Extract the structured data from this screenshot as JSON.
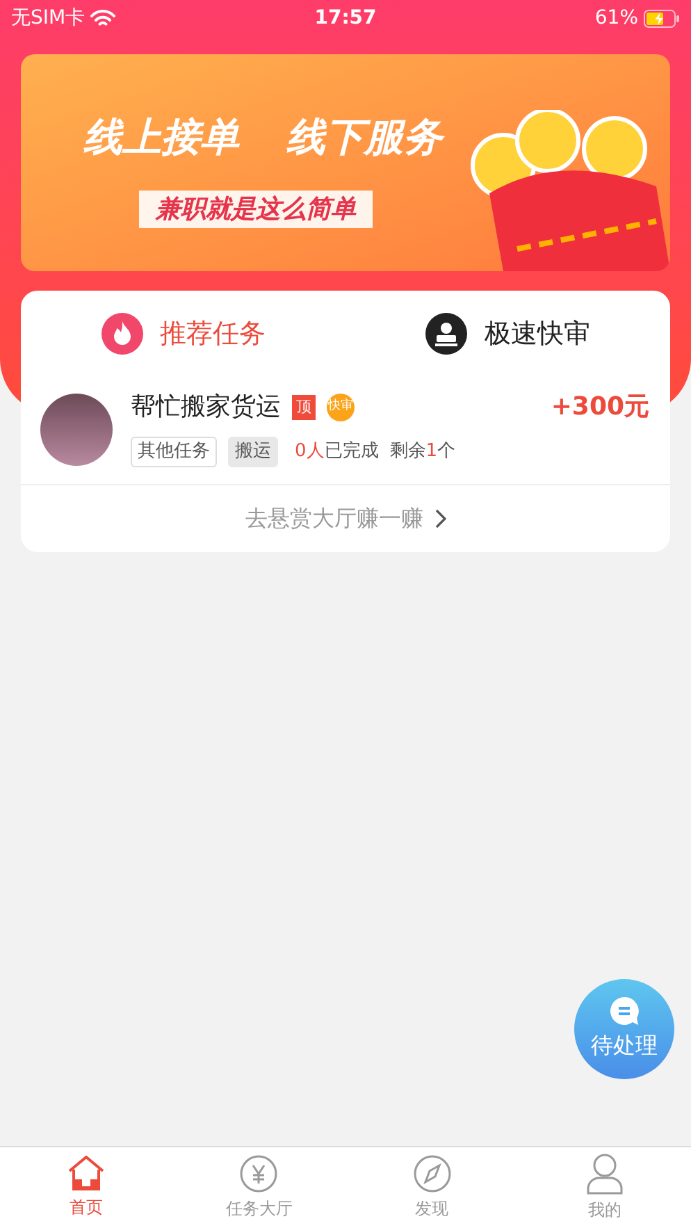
{
  "status_bar": {
    "carrier": "无SIM卡",
    "time": "17:57",
    "battery": "61%",
    "charging": true
  },
  "banner": {
    "headline_1": "线上接单",
    "headline_2": "线下服务",
    "slogan": "兼职就是这么简单"
  },
  "tabs": [
    {
      "label": "推荐任务",
      "kind": "flame",
      "selected": true
    },
    {
      "label": "极速快审",
      "kind": "stamp",
      "selected": false
    }
  ],
  "tasks": [
    {
      "title": "帮忙搬家货运",
      "top_badge": "顶",
      "fast_badge": "快审",
      "reward": "+300元",
      "tags": [
        {
          "label": "其他任务",
          "kind": "outline"
        },
        {
          "label": "搬运",
          "kind": "filled"
        }
      ],
      "completed_count": "0人",
      "completed_label": "已完成",
      "remaining_label": "剩余",
      "remaining_count": "1",
      "remaining_unit": "个"
    }
  ],
  "more_link": "去悬赏大厅赚一赚",
  "floating_button": "待处理",
  "nav": [
    {
      "label": "首页",
      "kind": "home",
      "selected": true
    },
    {
      "label": "任务大厅",
      "kind": "yen",
      "selected": false
    },
    {
      "label": "发现",
      "kind": "compass",
      "selected": false
    },
    {
      "label": "我的",
      "kind": "person",
      "selected": false
    }
  ]
}
